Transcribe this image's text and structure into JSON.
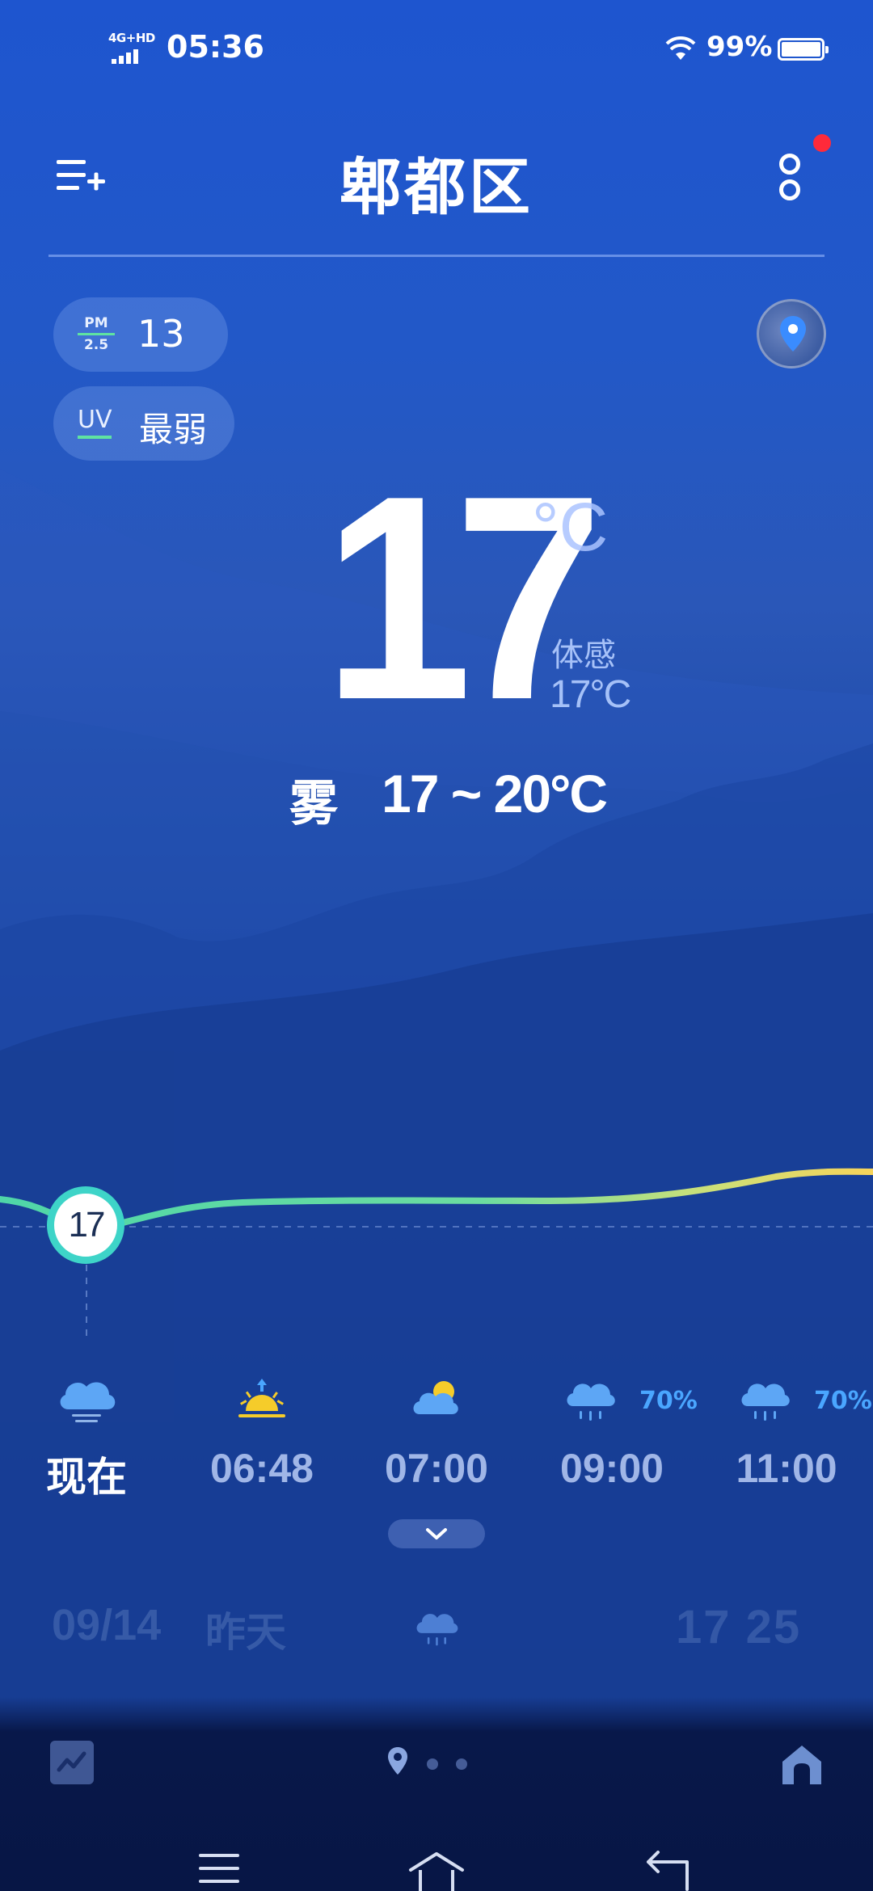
{
  "status_bar": {
    "network": "4G+HD",
    "time": "05:36",
    "battery": "99%"
  },
  "header": {
    "city": "郫都区"
  },
  "air": {
    "pm_label_top": "PM",
    "pm_label_bottom": "2.5",
    "pm_value": "13",
    "uv_label": "UV",
    "uv_value": "最弱"
  },
  "current": {
    "temperature": "17",
    "unit": "°C",
    "feels_label": "体感",
    "feels_value": "17°C",
    "condition": "雾",
    "range": "17 ~ 20°C",
    "curve_marker": "17"
  },
  "hourly": [
    {
      "time": "现在",
      "icon": "fog-cloud-icon",
      "precip": ""
    },
    {
      "time": "06:48",
      "icon": "sunrise-icon",
      "precip": ""
    },
    {
      "time": "07:00",
      "icon": "partly-cloudy-icon",
      "precip": ""
    },
    {
      "time": "09:00",
      "icon": "rain-cloud-icon",
      "precip": "70%"
    },
    {
      "time": "11:00",
      "icon": "rain-cloud-icon",
      "precip": "70%"
    }
  ],
  "daily": [
    {
      "date": "09/14",
      "day": "昨天",
      "icon": "rain-cloud-icon",
      "low": "17",
      "high": "25"
    }
  ],
  "colors": {
    "accent_curve_start": "#4fd6a8",
    "accent_curve_end": "#f7d45a",
    "precip": "#4aa6ff",
    "notification": "#ff2a3a"
  }
}
